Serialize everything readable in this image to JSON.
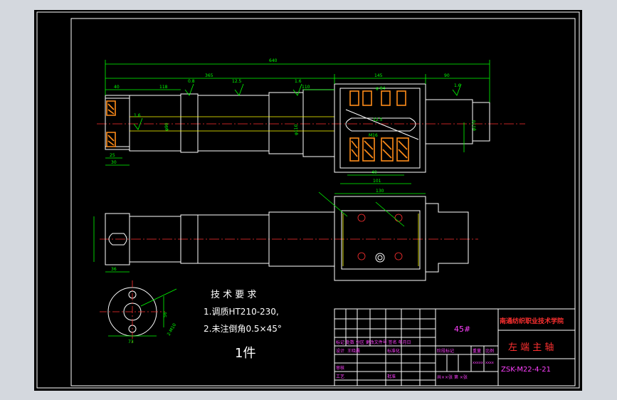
{
  "colors": {
    "background": "#000000",
    "frame": "#ffffff",
    "dimension": "#00ff00",
    "hatch": "#ff8c1a",
    "title_text": "#ff3030",
    "table_text": "#ff40ff",
    "tech_text": "#ffffff"
  },
  "technical_requirements": {
    "title": "技 术 要 求",
    "line1": "1.调质HT210-230,",
    "line2": "2.未注倒角0.5×45°",
    "quantity": "1件"
  },
  "title_block": {
    "material": "45#",
    "school": "南通纺织职业技术学院",
    "part_name": "左 端 主 轴",
    "drawing_no": "ZSK-M22-4-21",
    "revision_header": "标记 处数 分区 更改文件号 签名 年月日",
    "designer_label": "设计",
    "designer_name": "王晓晨",
    "standard_label": "标准化",
    "review_label": "审核",
    "process_label": "工艺",
    "approve_label": "批准",
    "stage_label": "阶段标记",
    "weight_label": "重量",
    "scale_label": "比例",
    "sheet_info": "共××张 第 ×张",
    "small1": "xxxxx",
    "small2": "xxxx"
  },
  "dimensions": {
    "overall": "640",
    "d365": "365",
    "d145": "145",
    "d90": "90",
    "d40": "40",
    "d118": "118",
    "d110": "110",
    "d94": "φ 94",
    "d40b": "40",
    "d101": "101",
    "d130": "130",
    "d25": "25",
    "d30": "30",
    "d36": "36",
    "d73": "73",
    "d56": "56",
    "m16": "M16",
    "d12_5a": "12.5",
    "d12_5b": "12.5",
    "d1_6a": "1.6",
    "d1_6b": "1.6",
    "d1_6c": "1.6",
    "d0_8": "0.8",
    "d170": "φ170",
    "d90p": "φ90",
    "d110p": "φ110",
    "m10": "2-M10"
  }
}
